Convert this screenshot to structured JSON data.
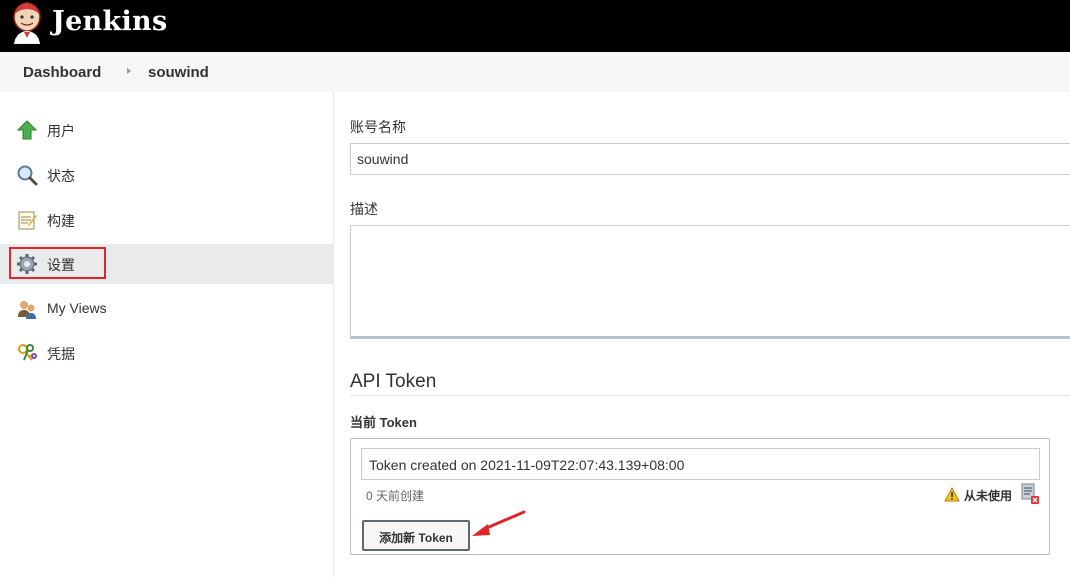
{
  "header": {
    "brand": "Jenkins"
  },
  "breadcrumb": {
    "items": [
      "Dashboard",
      "souwind"
    ]
  },
  "sidebar": {
    "items": [
      {
        "label": "用户",
        "icon": "up-arrow-icon"
      },
      {
        "label": "状态",
        "icon": "magnifier-icon"
      },
      {
        "label": "构建",
        "icon": "notepad-icon"
      },
      {
        "label": "设置",
        "icon": "gear-icon",
        "active": true
      },
      {
        "label": "My Views",
        "icon": "people-icon"
      },
      {
        "label": "凭据",
        "icon": "keys-icon"
      }
    ]
  },
  "form": {
    "account_label": "账号名称",
    "account_value": "souwind",
    "description_label": "描述",
    "description_value": ""
  },
  "api_token": {
    "title": "API Token",
    "current_label": "当前 Token",
    "token_value": "Token created on 2021-11-09T22:07:43.139+08:00",
    "age": "0 天前创建",
    "usage": "从未使用",
    "add_button": "添加新 Token"
  },
  "colors": {
    "header_bg": "#000000",
    "highlight_border": "#e0262b",
    "arrow": "#e0262b"
  }
}
